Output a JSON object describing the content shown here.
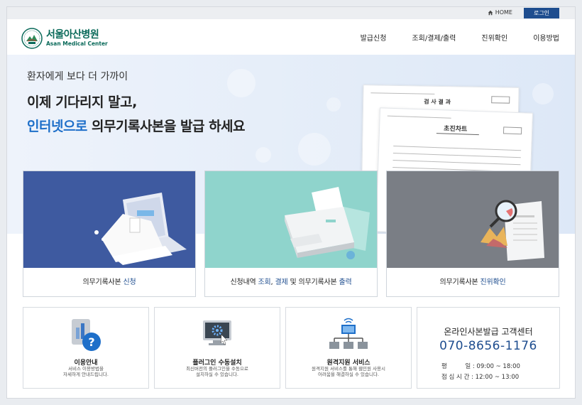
{
  "topbar": {
    "home_label": "HOME",
    "login_label": "로그인"
  },
  "logo": {
    "name_ko": "서울아산병원",
    "name_en": "Asan Medical Center"
  },
  "nav": {
    "items": [
      "발급신청",
      "조회/결제/출력",
      "진위확인",
      "이용방법"
    ]
  },
  "hero": {
    "subtitle": "환자에게 보다 더 가까이",
    "title_line1": "이제 기다리지 말고,",
    "title_line2_highlight": "인터넷으로",
    "title_line2_rest": " 의무기록사본을 발급 하세요",
    "doc_back_title": "검 사 결 과",
    "doc_front_title": "초진차트"
  },
  "cards": [
    {
      "label_prefix": "의무기록사본 ",
      "label_blue1": "신청",
      "label_mid": "",
      "label_blue2": "",
      "label_mid2": "",
      "label_blue3": ""
    },
    {
      "label_prefix": "신청내역 ",
      "label_blue1": "조회",
      "label_mid": ", ",
      "label_blue2": "결제",
      "label_mid2": " 및 의무기록사본 ",
      "label_blue3": "출력"
    },
    {
      "label_prefix": "의무기록사본 ",
      "label_blue1": "진위확인",
      "label_mid": "",
      "label_blue2": "",
      "label_mid2": "",
      "label_blue3": ""
    }
  ],
  "info_boxes": [
    {
      "title": "이용안내",
      "desc1": "서비스 이용방법을",
      "desc2": "자세하게 안내드립니다."
    },
    {
      "title": "플러그인 수동설치",
      "desc1": "최신버전의 플러그인을 수동으로",
      "desc2": "설치하실 수 있습니다."
    },
    {
      "title": "원격지원 서비스",
      "desc1": "원격지원 서비스를 통해 웹민원 사용시",
      "desc2": "어려움을 해결하실 수 있습니다."
    }
  ],
  "customer_center": {
    "title": "온라인사본발급 고객센터",
    "phone": "070-8656-1176",
    "weekday_label": "평　　　일",
    "weekday_hours": ": 09:00 ~ 18:00",
    "lunch_label": "점 심 시 간",
    "lunch_hours": ": 12:00 ~ 13:00"
  },
  "colors": {
    "brand_green": "#0a6a5a",
    "brand_blue": "#1e4d8f",
    "highlight_blue": "#1e6fc9",
    "card1_bg": "#3e5aa0",
    "card2_bg": "#8fd4cc",
    "card3_bg": "#7a7e85"
  },
  "icons": [
    "home-icon",
    "hospital-logo-icon",
    "help-icon",
    "plugin-install-icon",
    "remote-support-icon"
  ]
}
